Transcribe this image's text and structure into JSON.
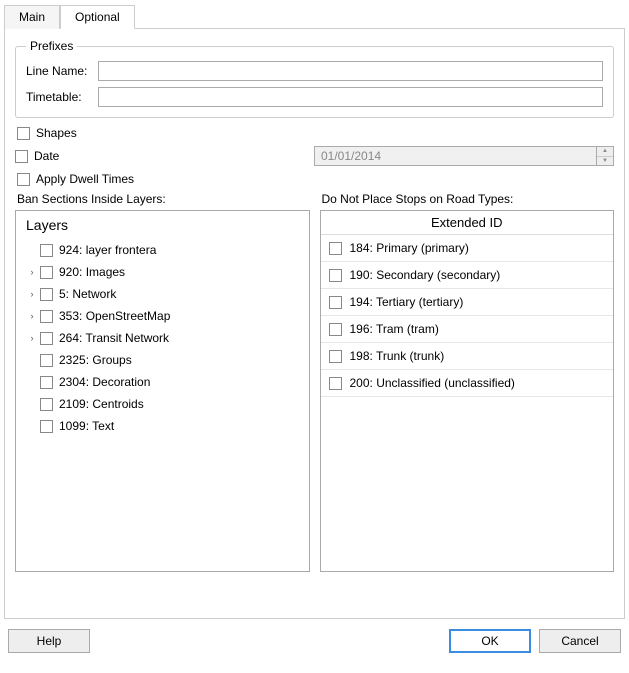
{
  "tabs": {
    "main": "Main",
    "optional": "Optional"
  },
  "prefixes": {
    "legend": "Prefixes",
    "line_name_label": "Line Name:",
    "line_name_value": "",
    "timetable_label": "Timetable:",
    "timetable_value": ""
  },
  "options": {
    "shapes_label": "Shapes",
    "date_label": "Date",
    "date_value": "01/01/2014",
    "apply_dwell_label": "Apply Dwell Times"
  },
  "columns": {
    "ban_sections_label": "Ban Sections Inside Layers:",
    "road_types_label": "Do Not Place Stops on Road Types:"
  },
  "layers": {
    "header": "Layers",
    "items": [
      {
        "expander": "",
        "label": "924: layer frontera"
      },
      {
        "expander": "›",
        "label": "920: Images"
      },
      {
        "expander": "›",
        "label": "5: Network"
      },
      {
        "expander": "›",
        "label": "353: OpenStreetMap"
      },
      {
        "expander": "›",
        "label": "264: Transit Network"
      },
      {
        "expander": "",
        "label": "2325: Groups"
      },
      {
        "expander": "",
        "label": "2304: Decoration"
      },
      {
        "expander": "",
        "label": "2109: Centroids"
      },
      {
        "expander": "",
        "label": "1099: Text"
      }
    ]
  },
  "roads": {
    "header": "Extended ID",
    "items": [
      {
        "label": "184: Primary (primary)"
      },
      {
        "label": "190: Secondary (secondary)"
      },
      {
        "label": "194: Tertiary (tertiary)"
      },
      {
        "label": "196: Tram (tram)"
      },
      {
        "label": "198: Trunk (trunk)"
      },
      {
        "label": "200: Unclassified (unclassified)"
      }
    ]
  },
  "buttons": {
    "help": "Help",
    "ok": "OK",
    "cancel": "Cancel"
  }
}
